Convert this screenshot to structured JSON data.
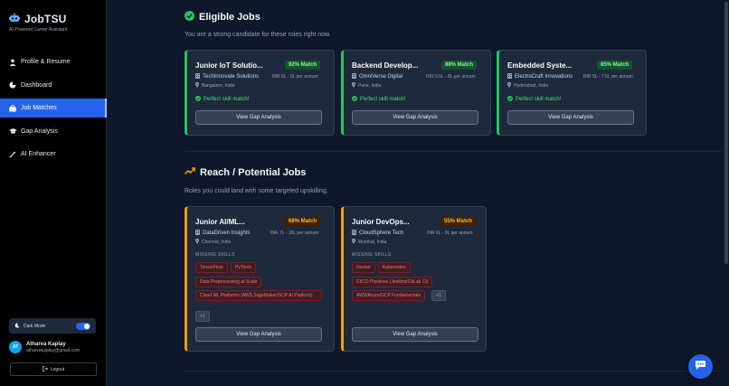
{
  "brand": {
    "name": "JobTSU",
    "subtitle": "AI-Powered Career Assistant",
    "icon": "robot-icon"
  },
  "nav": [
    {
      "label": "Profile & Resume",
      "icon": "user-icon",
      "active": false
    },
    {
      "label": "Dashboard",
      "icon": "pie-chart-icon",
      "active": false
    },
    {
      "label": "Job Matches",
      "icon": "briefcase-icon",
      "active": true
    },
    {
      "label": "Gap Analysis",
      "icon": "graduation-cap-icon",
      "active": false
    },
    {
      "label": "AI Enhancer",
      "icon": "magic-wand-icon",
      "active": false
    }
  ],
  "dark_mode": {
    "label": "Dark Mode",
    "enabled": true
  },
  "user": {
    "initials": "AT",
    "name": "Atharva Kaplay",
    "email": "atharvakaplay@gmail.com"
  },
  "logout_label": "Logout",
  "eligible": {
    "title": "Eligible Jobs",
    "subtitle": "You are a strong candidate for these roles right now.",
    "jobs": [
      {
        "title": "Junior IoT Solutio...",
        "match": "92% Match",
        "company": "TechInnovate Solutions",
        "salary": "INR 6L - 9L per annum",
        "location": "Bangalore, India",
        "perfect": "Perfect skill match!",
        "button": "View Gap Analysis"
      },
      {
        "title": "Backend Develop...",
        "match": "88% Match",
        "company": "OmniVerse Digital",
        "salary": "INR 5.5L - 8L per annum",
        "location": "Pune, India",
        "perfect": "Perfect skill match!",
        "button": "View Gap Analysis"
      },
      {
        "title": "Embedded Syste...",
        "match": "85% Match",
        "company": "ElectroCraft Innovations",
        "salary": "INR 5L - 7.5L per annum",
        "location": "Hyderabad, India",
        "perfect": "Perfect skill match!",
        "button": "View Gap Analysis"
      }
    ]
  },
  "reach": {
    "title": "Reach / Potential Jobs",
    "subtitle": "Roles you could land with some targeted upskilling.",
    "missing_label": "MISSING SKILLS",
    "jobs": [
      {
        "title": "Junior AI/ML...",
        "match": "68% Match",
        "company": "DataDriven Insights",
        "salary": "INR 7L - 10L per annum",
        "location": "Chennai, India",
        "skills": [
          "TensorFlow",
          "PyTorch",
          "Data Preprocessing at Scale",
          "Cloud ML Platforms (AWS SageMaker/GCP AI Platform)"
        ],
        "more": "+1",
        "button": "View Gap Analysis"
      },
      {
        "title": "Junior DevOps...",
        "match": "55% Match",
        "company": "CloudSphere Tech",
        "salary": "INR 6L - 9L per annum",
        "location": "Mumbai, India",
        "skills": [
          "Docker",
          "Kubernetes",
          "CI/CD Pipelines (Jenkins/GitLab CI)",
          "AWS/Azure/GCP Fundamentals"
        ],
        "more": "+1",
        "button": "View Gap Analysis"
      }
    ]
  },
  "colors": {
    "accent": "#2563eb",
    "eligible": "#22c55e",
    "reach": "#f59e0b",
    "chip_text": "#f87171"
  }
}
